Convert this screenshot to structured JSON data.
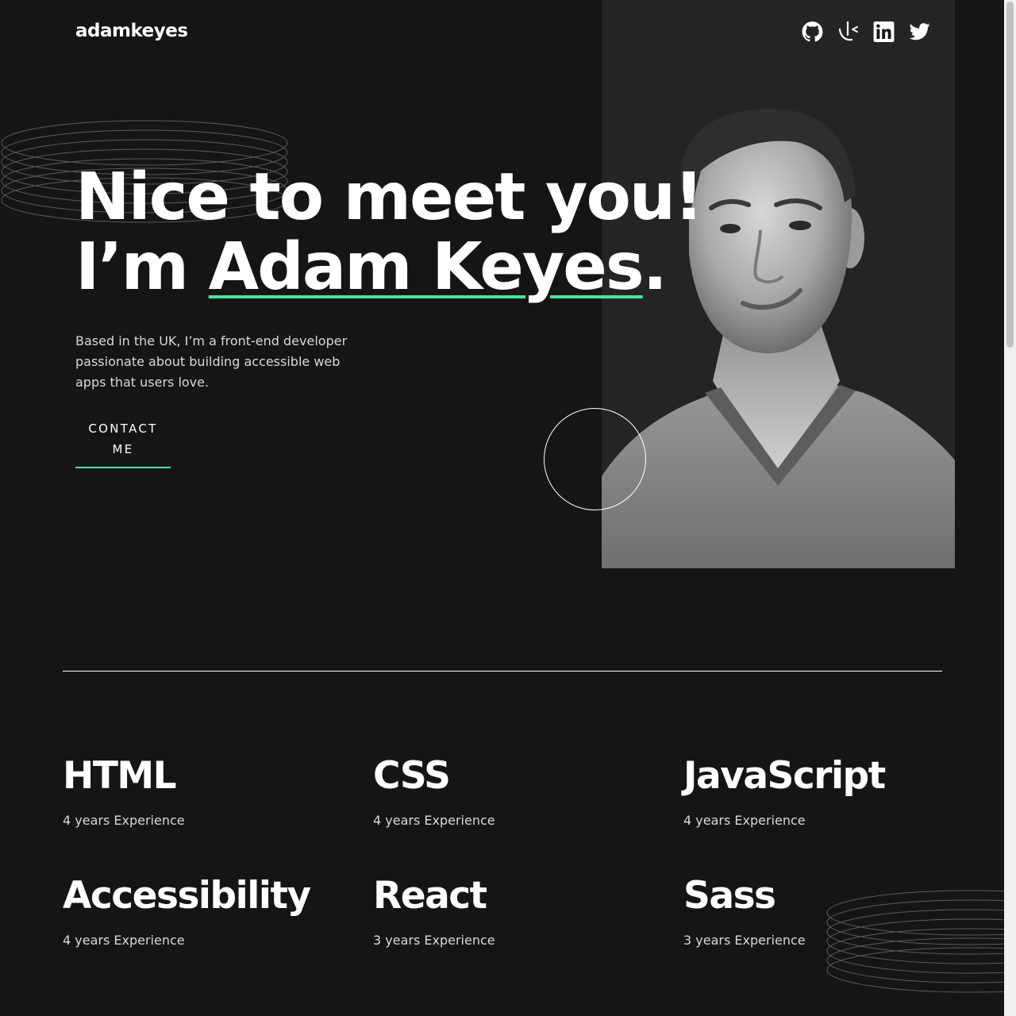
{
  "header": {
    "logo": "adamkeyes",
    "social": [
      {
        "name": "github",
        "icon": "github-icon"
      },
      {
        "name": "frontend-mentor",
        "icon": "frontend-mentor-icon"
      },
      {
        "name": "linkedin",
        "icon": "linkedin-icon"
      },
      {
        "name": "twitter",
        "icon": "twitter-icon"
      }
    ]
  },
  "hero": {
    "line1": "Nice to meet you!",
    "line2_prefix": "I’m ",
    "name": "Adam Keyes",
    "line2_suffix": ".",
    "description": "Based in the UK, I’m a front-end developer passionate about building accessible web apps that users love.",
    "contact_label": "CONTACT ME"
  },
  "skills": [
    {
      "name": "HTML",
      "experience": "4 years Experience"
    },
    {
      "name": "CSS",
      "experience": "4 years Experience"
    },
    {
      "name": "JavaScript",
      "experience": "4 years Experience"
    },
    {
      "name": "Accessibility",
      "experience": "4 years Experience"
    },
    {
      "name": "React",
      "experience": "3 years Experience"
    },
    {
      "name": "Sass",
      "experience": "3 years Experience"
    }
  ],
  "colors": {
    "background": "#151515",
    "panel": "#242424",
    "accent": "#4ee1a0",
    "text": "#ffffff",
    "muted": "#d9d9d9"
  }
}
